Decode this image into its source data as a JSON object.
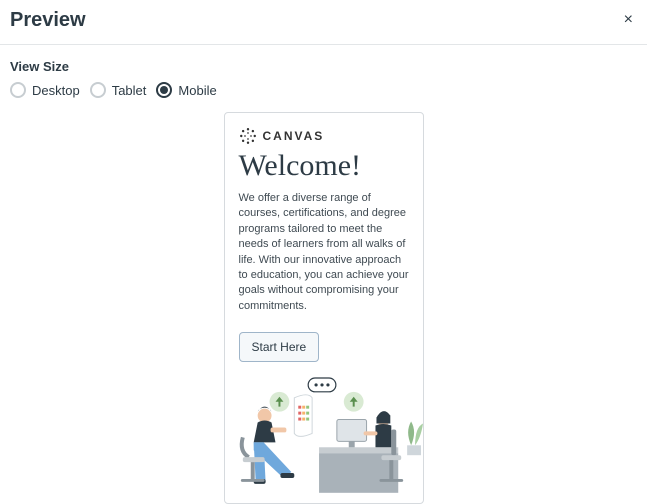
{
  "header": {
    "title": "Preview",
    "close_label": "×"
  },
  "viewsize": {
    "label": "View Size",
    "options": [
      {
        "key": "desktop",
        "label": "Desktop",
        "selected": false
      },
      {
        "key": "tablet",
        "label": "Tablet",
        "selected": false
      },
      {
        "key": "mobile",
        "label": "Mobile",
        "selected": true
      }
    ]
  },
  "content": {
    "brand": "CANVAS",
    "heading": "Welcome!",
    "body": "We offer a diverse range of courses, certifications, and degree programs tailored to meet the needs of learners from all walks of life. With our innovative approach to education, you can achieve your goals without compromising your commitments.",
    "cta": "Start Here"
  }
}
